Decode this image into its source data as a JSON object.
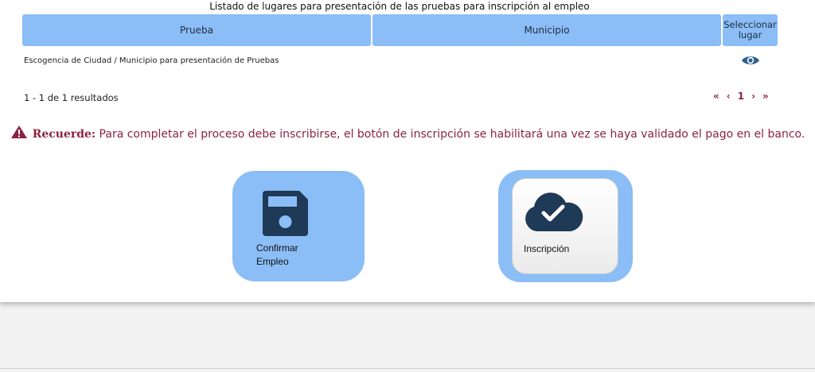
{
  "table": {
    "caption": "Listado de lugares para presentación de las pruebas para inscripción al empleo",
    "headers": [
      "Prueba",
      "Municipio",
      "Seleccionar lugar"
    ],
    "rows": [
      {
        "prueba": "Escogencia de Ciudad / Municipio para presentación de Pruebas",
        "municipio": "",
        "action_icon": "eye-icon"
      }
    ]
  },
  "pagination": {
    "summary": "1 - 1 de 1 resultados",
    "first": "«",
    "prev": "‹",
    "current": "1",
    "next": "›",
    "last": "»"
  },
  "notice": {
    "label": "Recuerde:",
    "text": "Para completar el proceso debe inscribirse, el botón de inscripción se habilitará una vez se haya validado el pago en el banco.",
    "icon": "warning-icon"
  },
  "actions": {
    "confirm_line1": "Confirmar",
    "confirm_line2": "Empleo",
    "confirm_icon": "floppy-disk-icon",
    "inscription_label": "Inscripción",
    "inscription_icon": "cloud-check-icon"
  },
  "colors": {
    "header_bg": "#8bbdf7",
    "accent_dark_red": "#8b2340",
    "icon_dark_blue": "#1f3a57",
    "eye_icon": "#2f5f8f"
  }
}
